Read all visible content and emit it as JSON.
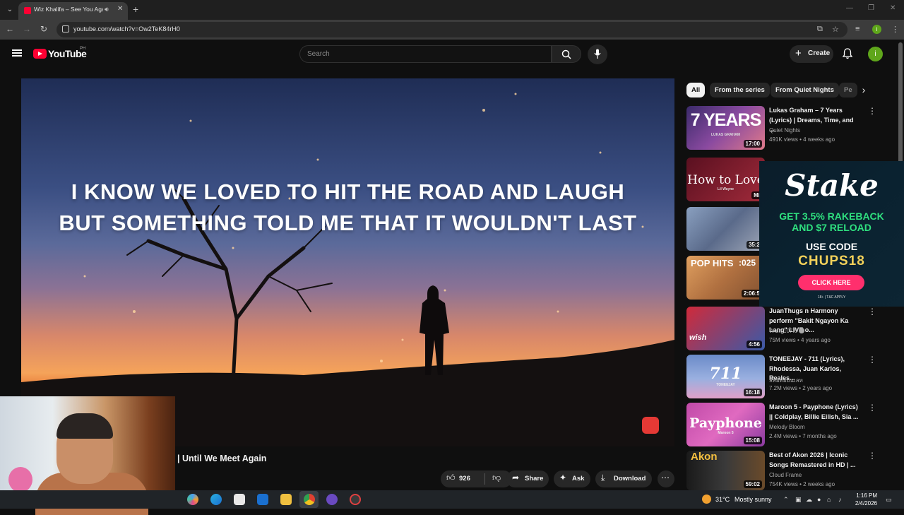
{
  "browser": {
    "tab_title": "Wiz Khalifa – See You Again",
    "url": "youtube.com/watch?v=Ow2TeK84rH0",
    "new_tab": "+",
    "tab_close": "✕"
  },
  "youtube": {
    "logo_text": "YouTube",
    "country": "PH",
    "search_placeholder": "Search",
    "create_label": "Create",
    "avatar_letter": "i"
  },
  "player": {
    "lyric_line_1": "I KNOW WE LOVED TO HIT THE ROAD AND LAUGH",
    "lyric_line_2": "BUT SOMETHING TOLD ME THAT IT WOULDN'T LAST",
    "title_visible": "| Until We Meet Again"
  },
  "actions": {
    "like_count": "926",
    "share": "Share",
    "ask": "Ask",
    "download": "Download"
  },
  "chips": [
    "All",
    "From the series",
    "From Quiet Nights",
    "Pe"
  ],
  "recommendations": [
    {
      "thumb_text": "7 YEARS",
      "thumb_sub": "LUKAS GRAHAM",
      "duration": "17:00",
      "title": "Lukas Graham – 7 Years (Lyrics) | Dreams, Time, and ...",
      "channel": "Quiet Nights",
      "meta": "491K views • 4 weeks ago",
      "thumb_color": "#6b4a8a"
    },
    {
      "thumb_text": "How to Love",
      "thumb_sub": "Lil Wayne",
      "duration": "Mi",
      "title": "",
      "channel": "",
      "meta": "",
      "thumb_color": "#8a2a3a"
    },
    {
      "thumb_text": "",
      "thumb_sub": "",
      "duration": "35:2",
      "title": "",
      "channel": "",
      "meta": "",
      "thumb_color": "#5a6a8a"
    },
    {
      "thumb_text": "POP HITS",
      "thumb_sub": ":025",
      "duration": "2:06:5",
      "title": "",
      "channel": "",
      "meta": "",
      "thumb_color": "#c08a4a"
    },
    {
      "thumb_text": "",
      "thumb_sub": "wish",
      "duration": "4:56",
      "title": "JuanThugs n Harmony perform \"Bakit Ngayon Ka Lang\" LIVE o...",
      "channel": "Wish 107.5",
      "meta": "75M views • 4 years ago",
      "thumb_color": "#c9303a"
    },
    {
      "thumb_text": "711",
      "thumb_sub": "TONEEJAY",
      "duration": "16:18",
      "title": "TONEEJAY - 711 (Lyrics), Rhodessa, Juan Karlos, Reales...",
      "channel": "สล็อตออนเลท",
      "meta": "7.2M views • 2 years ago",
      "thumb_color": "#3a5aa8"
    },
    {
      "thumb_text": "Payphone",
      "thumb_sub": "Maroon 5",
      "duration": "15:08",
      "title": "Maroon 5 - Payphone (Lyrics) || Coldplay, Billie Eilish, Sia ...",
      "channel": "Melody Bloom",
      "meta": "2.4M views • 7 months ago",
      "thumb_color": "#b03a9a"
    },
    {
      "thumb_text": "Akon",
      "thumb_sub": "",
      "duration": "59:02",
      "title": "Best of Akon 2026 | Iconic Songs Remastered in HD | ...",
      "channel": "Cloud Frame",
      "meta": "754K views • 2 weeks ago",
      "thumb_color": "#2a2a2a"
    }
  ],
  "ad": {
    "brand": "Stake",
    "line1": "GET 3.5% RAKEBACK",
    "line2": "AND $7 RELOAD",
    "use_code": "USE CODE",
    "code": "CHUPS18",
    "cta": "CLICK HERE",
    "fine": "18+ | T&C APPLY"
  },
  "taskbar": {
    "temp": "31°C",
    "weather": "Mostly sunny",
    "time": "1:16 PM",
    "date": "2/4/2026"
  }
}
